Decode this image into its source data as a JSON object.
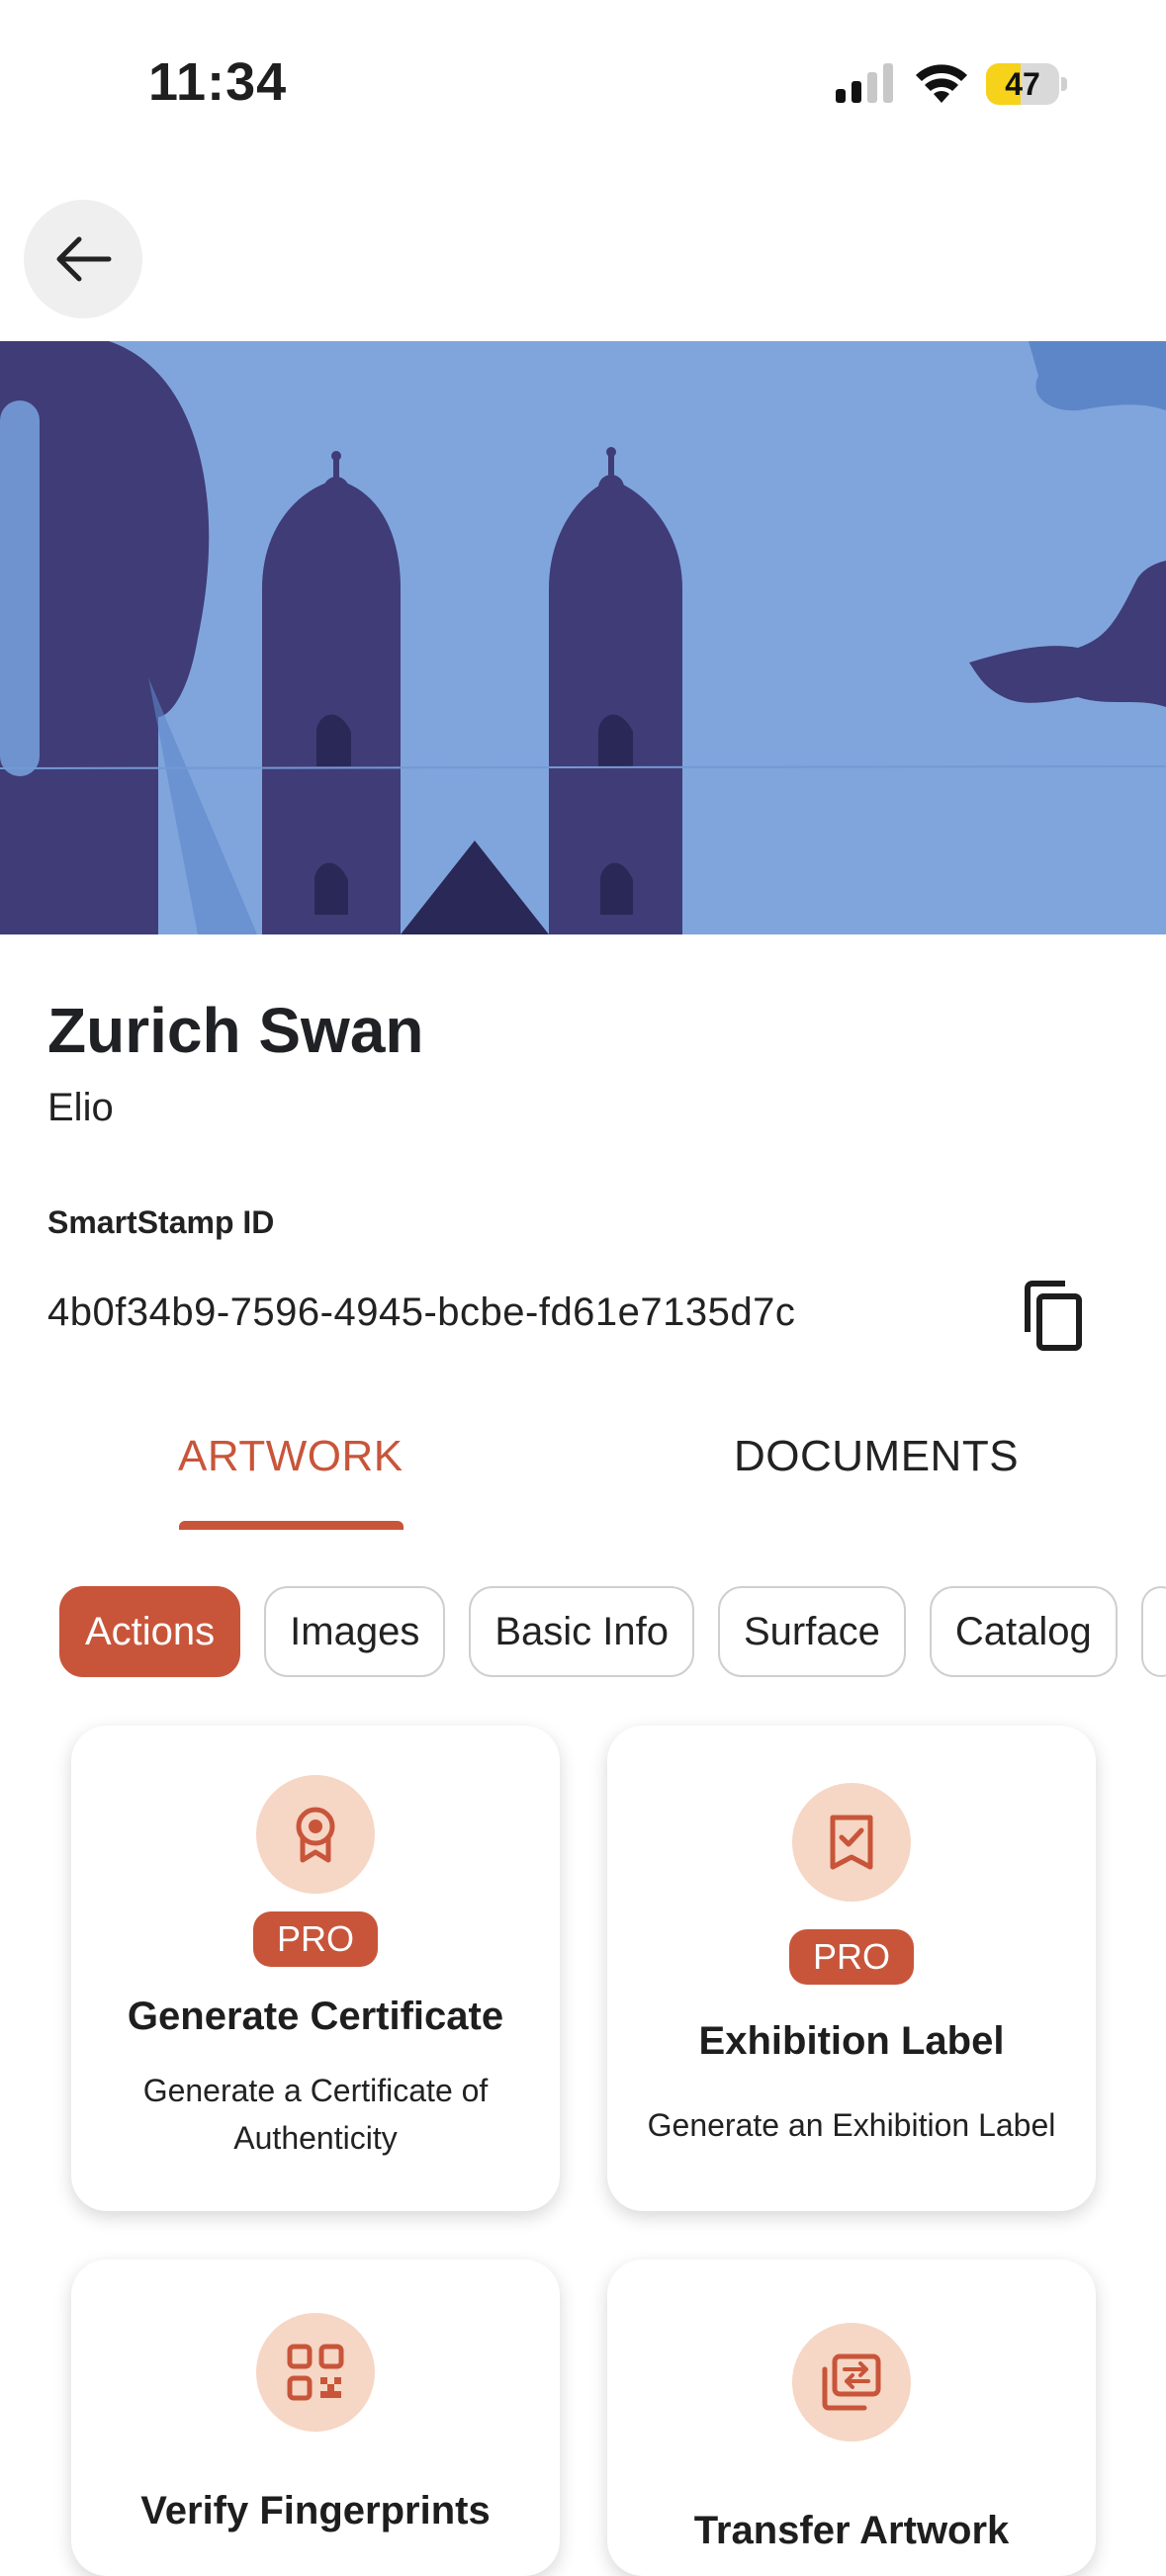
{
  "status_bar": {
    "time": "11:34",
    "battery_percent": "47",
    "battery_level": 0.47,
    "battery_color": "#f6d21a"
  },
  "artwork": {
    "title": "Zurich Swan",
    "artist": "Elio",
    "smartstamp_label": "SmartStamp ID",
    "smartstamp_id": "4b0f34b9-7596-4945-bcbe-fd61e7135d7c"
  },
  "tabs": [
    {
      "label": "ARTWORK",
      "active": true
    },
    {
      "label": "DOCUMENTS",
      "active": false
    }
  ],
  "chips": [
    {
      "label": "Actions",
      "active": true
    },
    {
      "label": "Images",
      "active": false
    },
    {
      "label": "Basic Info",
      "active": false
    },
    {
      "label": "Surface",
      "active": false
    },
    {
      "label": "Catalog",
      "active": false
    }
  ],
  "cards": [
    {
      "icon": "certificate-ribbon-icon",
      "badge": "PRO",
      "title": "Generate Certificate",
      "desc": "Generate a Certificate of Authenticity"
    },
    {
      "icon": "bookmark-check-icon",
      "badge": "PRO",
      "title": "Exhibition Label",
      "desc": "Generate an Exhibition Label"
    },
    {
      "icon": "qr-code-icon",
      "title": "Verify Fingerprints"
    },
    {
      "icon": "transfer-icon",
      "title": "Transfer Artwork"
    }
  ],
  "colors": {
    "accent": "#c8553a",
    "icon_bg": "#f6d6c4",
    "hero_sky": "#80a5dc",
    "hero_silhouette": "#413f78"
  }
}
